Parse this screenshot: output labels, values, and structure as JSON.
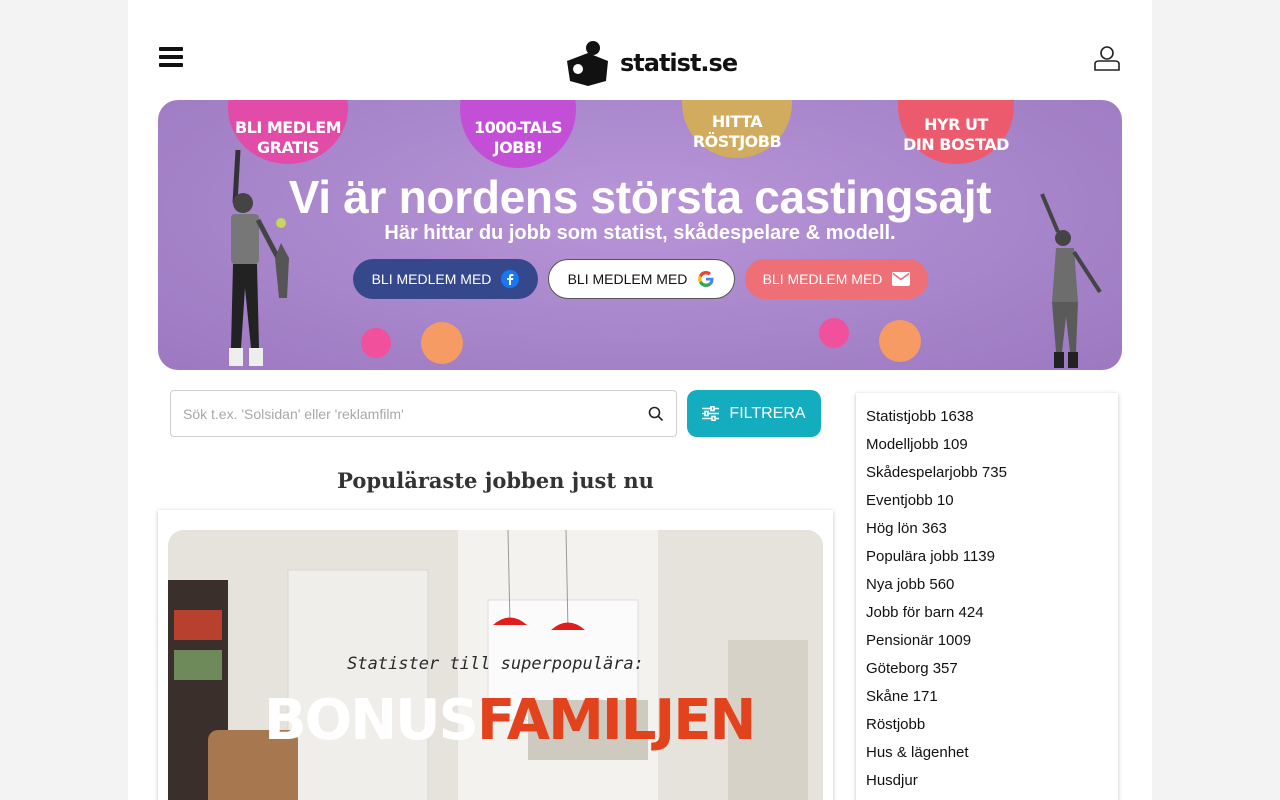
{
  "header": {
    "logo_text": "statist.se",
    "menu_icon": "hamburger-menu-icon",
    "user_icon": "user-profile-icon"
  },
  "hero": {
    "bubbles": [
      {
        "line1": "BLI MEDLEM",
        "line2": "GRATIS"
      },
      {
        "line1": "1000-TALS",
        "line2": "JOBB!"
      },
      {
        "line1": "HITTA",
        "line2": "RÖSTJOBB"
      },
      {
        "line1": "HYR UT",
        "line2": "DIN BOSTAD"
      }
    ],
    "title": "Vi är nordens största castingsajt",
    "subtitle": "Här hittar du jobb som statist, skådespelare & modell.",
    "cta_facebook": "BLI MEDLEM MED",
    "cta_google": "BLI MEDLEM MED",
    "cta_email": "BLI MEDLEM MED",
    "colors": {
      "facebook": "#35488c",
      "email": "#ee6f76",
      "bg": "#a886cb"
    }
  },
  "search": {
    "placeholder": "Sök t.ex. 'Solsidan' eller 'reklamfilm'",
    "value": ""
  },
  "filter": {
    "label": "FILTRERA",
    "color": "#14adc0"
  },
  "popular": {
    "title": "Populäraste jobben just nu",
    "card": {
      "tagline": "Statister till superpopulära:",
      "brand_part1": "BONUS",
      "brand_part2": "FAMILJEN"
    }
  },
  "sidebar": {
    "items": [
      {
        "label": "Statistjobb 1638"
      },
      {
        "label": "Modelljobb 109"
      },
      {
        "label": "Skådespelarjobb 735"
      },
      {
        "label": "Eventjobb 10"
      },
      {
        "label": "Hög lön 363"
      },
      {
        "label": "Populära jobb 1139"
      },
      {
        "label": "Nya jobb 560"
      },
      {
        "label": "Jobb för barn 424"
      },
      {
        "label": "Pensionär 1009"
      },
      {
        "label": "Göteborg 357"
      },
      {
        "label": "Skåne 171"
      },
      {
        "label": "Röstjobb"
      },
      {
        "label": "Hus & lägenhet"
      },
      {
        "label": "Husdjur"
      }
    ]
  }
}
